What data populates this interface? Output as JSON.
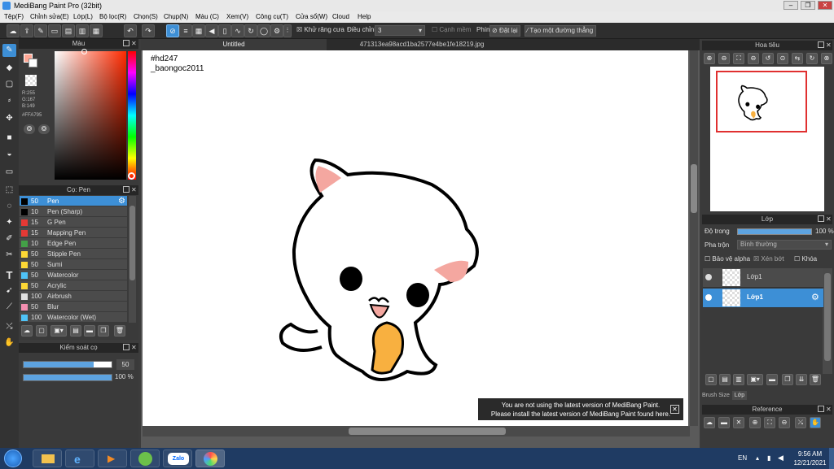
{
  "window": {
    "title": "MediBang Paint Pro (32bit)"
  },
  "menu": [
    "Tệp(F)",
    "Chỉnh sửa(E)",
    "Lớp(L)",
    "Bộ lọc(R)",
    "Chọn(S)",
    "Chụp(N)",
    "Màu (C)",
    "Xem(V)",
    "Công cụ(T)",
    "Cửa sổ(W)",
    "Cloud",
    "Help"
  ],
  "toolbar": {
    "antialias_label": "Khử răng cưa",
    "adjust_label": "Điều chỉnh",
    "adjust_value": "3",
    "edge_label": "Cạnh mềm",
    "key_label": "Phím",
    "reset_label": "Đặt lại",
    "straight_label": "Tạo một đường thẳng"
  },
  "colors": {
    "accent": "#3d8fd6",
    "current": "#FFA795"
  },
  "color_panel": {
    "title": "Màu",
    "r": "R:255",
    "g": "G:167",
    "b": "B:149",
    "hex": "#FFA795"
  },
  "brush_panel": {
    "title": "Cọ: Pen",
    "brushes": [
      {
        "size": "50",
        "name": "Pen",
        "color": "#000000",
        "selected": true
      },
      {
        "size": "10",
        "name": "Pen (Sharp)",
        "color": "#000000"
      },
      {
        "size": "15",
        "name": "G Pen",
        "color": "#e53935"
      },
      {
        "size": "15",
        "name": "Mapping Pen",
        "color": "#e53935"
      },
      {
        "size": "10",
        "name": "Edge Pen",
        "color": "#43a047"
      },
      {
        "size": "50",
        "name": "Stipple Pen",
        "color": "#fdd835"
      },
      {
        "size": "50",
        "name": "Sumi",
        "color": "#fdd835"
      },
      {
        "size": "50",
        "name": "Watercolor",
        "color": "#4fc3f7"
      },
      {
        "size": "50",
        "name": "Acrylic",
        "color": "#fdd835"
      },
      {
        "size": "100",
        "name": "Airbrush",
        "color": "#e0e0e0"
      },
      {
        "size": "50",
        "name": "Blur",
        "color": "#f48fb1"
      },
      {
        "size": "100",
        "name": "Watercolor (Wet)",
        "color": "#4fc3f7"
      }
    ]
  },
  "control_panel": {
    "title": "Kiểm soát cọ",
    "size_value": "50",
    "opacity_value": "100 %",
    "size_fraction": 0.8,
    "opacity_fraction": 1.0
  },
  "tabs": {
    "first": "Untitled",
    "second": "471313ea98acd1ba2577e4be1fe18219.jpg"
  },
  "canvas_text": {
    "line1": "#hd247",
    "line2": "_baongoc2011"
  },
  "notice": {
    "line1": "You are not using the latest version of MediBang Paint.",
    "line2": "Please install the latest version of MediBang Paint found here.",
    "close": "✕"
  },
  "navigator": {
    "title": "Hoa tiêu"
  },
  "layer_panel": {
    "title": "Lớp",
    "opacity_label": "Độ trong",
    "opacity_value": "100 %",
    "blend_label": "Pha trộn",
    "blend_value": "Bình thường",
    "protect_alpha": "Bảo vệ alpha",
    "clipping": "Xén bớt",
    "lock": "Khóa",
    "layers": [
      {
        "name": "Lớp1"
      },
      {
        "name": "Lớp1",
        "selected": true
      }
    ],
    "tab_brush_size": "Brush Size",
    "tab_layer": "Lớp"
  },
  "reference_panel": {
    "title": "Reference"
  },
  "taskbar": {
    "lang": "EN",
    "time": "9:56 AM",
    "date": "12/21/2021",
    "zalo_label": "Zalo"
  }
}
